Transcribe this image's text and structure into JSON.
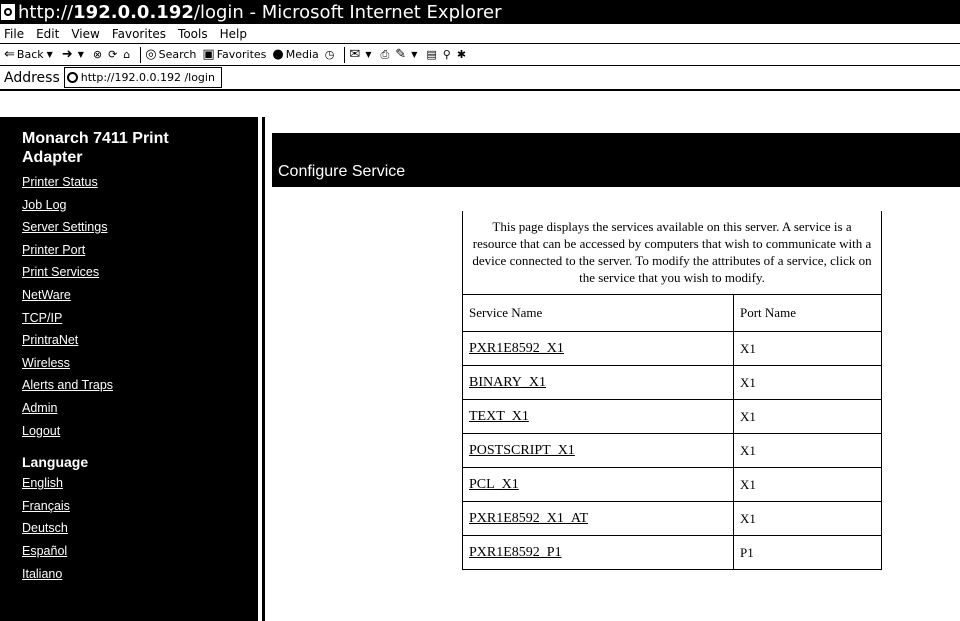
{
  "window": {
    "title_prefix": "http:// ",
    "title_host": "192.0.0.192",
    "title_suffix": " /login - Microsoft Internet Explorer"
  },
  "menubar": {
    "items": [
      "File",
      "Edit",
      "View",
      "Favorites",
      "Tools",
      "Help"
    ]
  },
  "toolbar": {
    "back_label": "Back",
    "search_label": "Search",
    "favorites_label": "Favorites",
    "media_label": "Media"
  },
  "address": {
    "label": "Address",
    "url": "http://192.0.0.192 /login"
  },
  "sidebar": {
    "brand": "Monarch 7411 Print Adapter",
    "nav": [
      "Printer Status",
      "Job Log",
      "Server Settings",
      "Printer Port",
      "Print Services",
      "NetWare",
      "TCP/IP",
      "PrintraNet",
      "Wireless",
      "Alerts and Traps",
      "Admin",
      "Logout"
    ],
    "language_heading": "Language",
    "languages": [
      "English",
      "Français",
      "Deutsch",
      "Español",
      "Italiano"
    ]
  },
  "main": {
    "heading": "Configure Service",
    "intro": "This page displays the services available on this server. A service is a resource that can be accessed by computers that wish to communicate with a device connected to the server. To modify the attributes of a service, click on the service that you wish to modify.",
    "columns": [
      "Service Name",
      "Port Name"
    ],
    "rows": [
      {
        "service": "PXR1E8592_X1",
        "port": "X1"
      },
      {
        "service": "BINARY_X1",
        "port": "X1"
      },
      {
        "service": "TEXT_X1",
        "port": "X1"
      },
      {
        "service": "POSTSCRIPT_X1",
        "port": "X1"
      },
      {
        "service": "PCL_X1",
        "port": "X1"
      },
      {
        "service": "PXR1E8592_X1_AT",
        "port": "X1"
      },
      {
        "service": "PXR1E8592_P1",
        "port": "P1"
      }
    ]
  }
}
